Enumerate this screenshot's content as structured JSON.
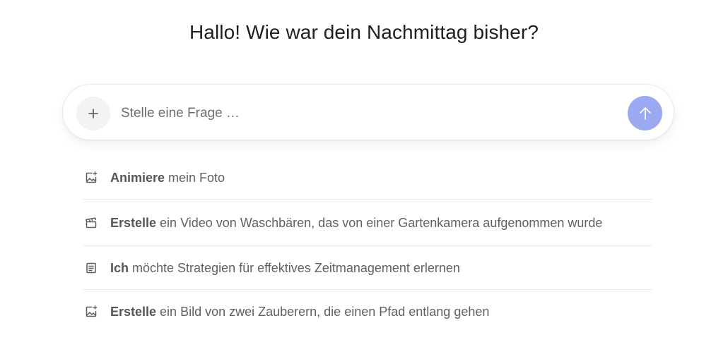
{
  "greeting": "Hallo! Wie war dein Nachmittag bisher?",
  "composer": {
    "placeholder": "Stelle eine Frage …",
    "plus_icon": "plus-icon",
    "send_icon": "arrow-up-icon",
    "send_color": "#9aa9f1"
  },
  "suggestions": [
    {
      "icon": "image-sparkle-icon",
      "bold": "Animiere",
      "rest": " mein Foto"
    },
    {
      "icon": "clapperboard-icon",
      "bold": "Erstelle",
      "rest": " ein Video von Waschbären, das von einer Gartenkamera aufgenommen wurde"
    },
    {
      "icon": "document-icon",
      "bold": "Ich",
      "rest": " möchte Strategien für effektives Zeitmanagement erlernen"
    },
    {
      "icon": "image-sparkle-icon",
      "bold": "Erstelle",
      "rest": " ein Bild von zwei Zauberern, die einen Pfad entlang gehen"
    }
  ]
}
